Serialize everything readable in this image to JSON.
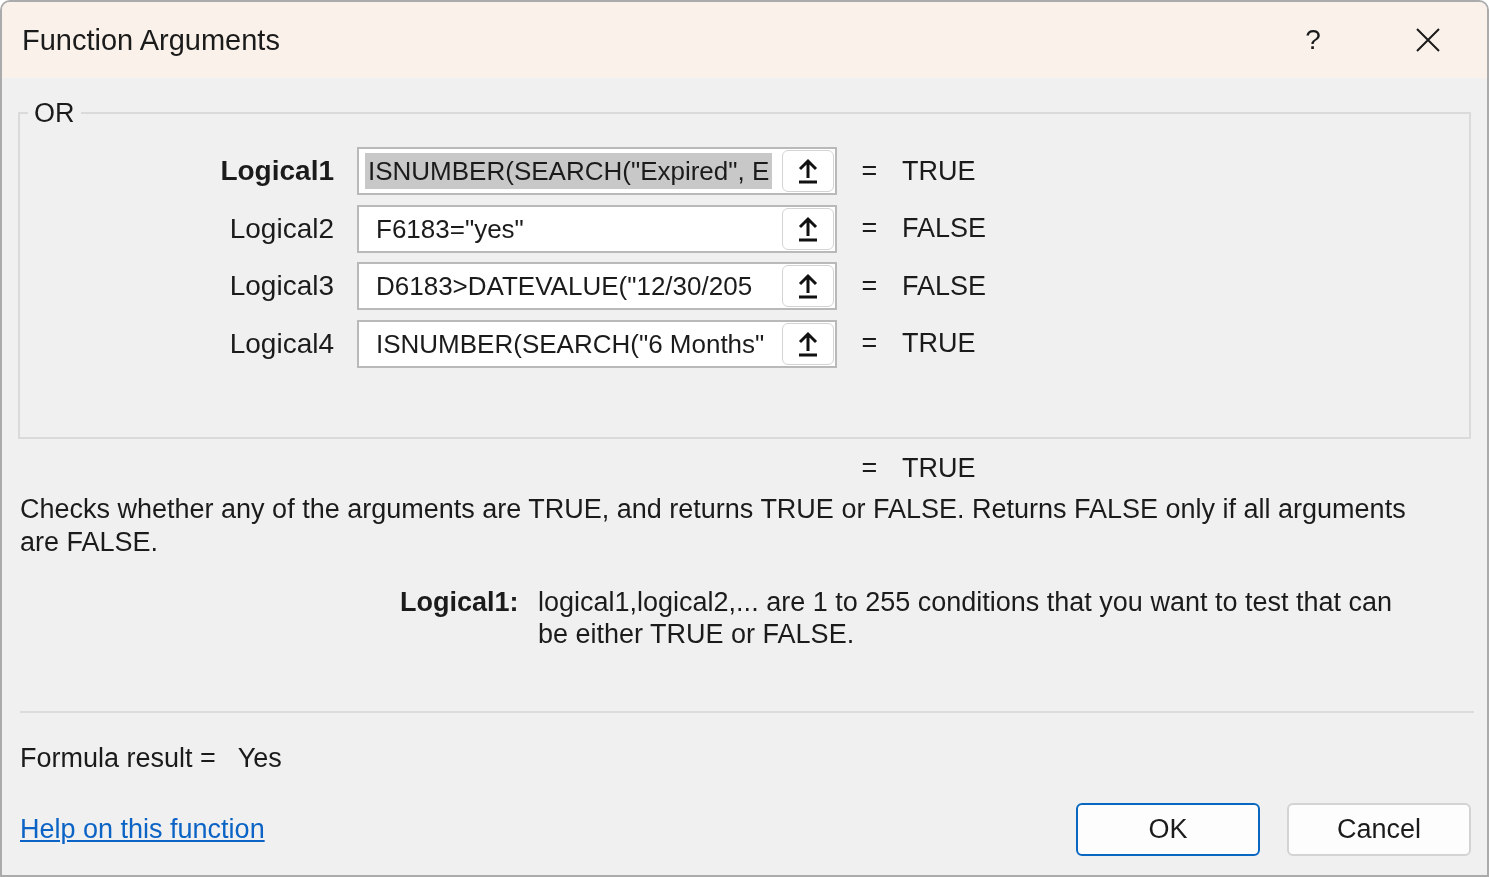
{
  "window": {
    "title": "Function Arguments",
    "help_button": "?"
  },
  "function_name": "OR",
  "arguments": [
    {
      "label": "Logical1",
      "value": "ISNUMBER(SEARCH(\"Expired\", E",
      "equals": "=",
      "result": "TRUE",
      "selected": true
    },
    {
      "label": "Logical2",
      "value": "F6183=\"yes\"",
      "equals": "=",
      "result": "FALSE",
      "selected": false
    },
    {
      "label": "Logical3",
      "value": "D6183>DATEVALUE(\"12/30/205",
      "equals": "=",
      "result": "FALSE",
      "selected": false
    },
    {
      "label": "Logical4",
      "value": "ISNUMBER(SEARCH(\"6 Months\"",
      "equals": "=",
      "result": "TRUE",
      "selected": false
    }
  ],
  "result": {
    "equals": "=",
    "value": "TRUE"
  },
  "description": "Checks whether any of the arguments are TRUE, and returns TRUE or FALSE. Returns FALSE only if all arguments are FALSE.",
  "argument_help": {
    "label": "Logical1:",
    "text": "logical1,logical2,... are 1 to 255 conditions that you want to test that can be either TRUE or FALSE."
  },
  "formula_result": {
    "label": "Formula result =",
    "value": "Yes"
  },
  "help_link": "Help on this function",
  "buttons": [
    {
      "label": "OK",
      "default": true
    },
    {
      "label": "Cancel",
      "default": false
    }
  ]
}
